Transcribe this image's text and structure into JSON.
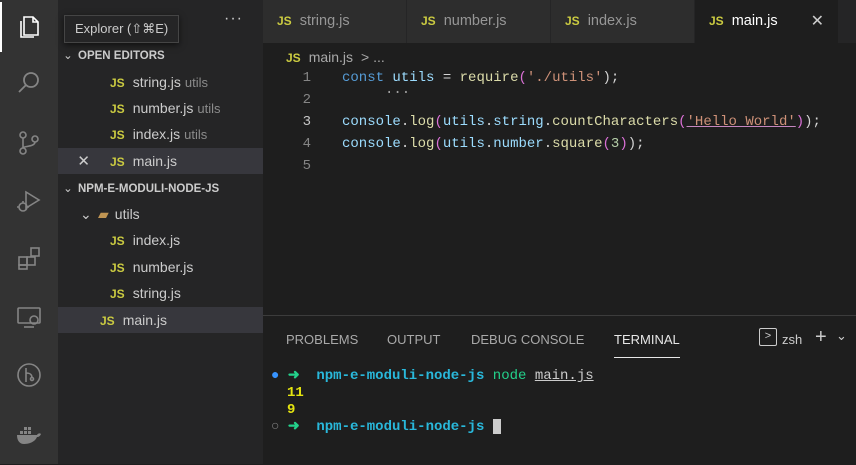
{
  "activity_bar": {
    "icons": [
      "files-icon",
      "search-icon",
      "source-control-icon",
      "run-debug-icon",
      "extensions-icon",
      "remote-explorer-icon",
      "git-graph-icon",
      "docker-icon"
    ]
  },
  "sidebar": {
    "tooltip": "Explorer (⇧⌘E)",
    "more_actions": "···",
    "open_editors": {
      "title": "OPEN EDITORS",
      "items": [
        {
          "badge": "JS",
          "name": "string.js",
          "dir": "utils"
        },
        {
          "badge": "JS",
          "name": "number.js",
          "dir": "utils"
        },
        {
          "badge": "JS",
          "name": "index.js",
          "dir": "utils"
        },
        {
          "badge": "JS",
          "name": "main.js",
          "dir": ""
        }
      ]
    },
    "project": {
      "title": "NPM-E-MODULI-NODE-JS",
      "folder": "utils",
      "files": [
        {
          "badge": "JS",
          "name": "index.js"
        },
        {
          "badge": "JS",
          "name": "number.js"
        },
        {
          "badge": "JS",
          "name": "string.js"
        }
      ],
      "root_files": [
        {
          "badge": "JS",
          "name": "main.js"
        }
      ]
    }
  },
  "tabs": [
    {
      "badge": "JS",
      "label": "string.js"
    },
    {
      "badge": "JS",
      "label": "number.js"
    },
    {
      "badge": "JS",
      "label": "index.js"
    },
    {
      "badge": "JS",
      "label": "main.js",
      "close": "✕"
    }
  ],
  "breadcrumb": {
    "badge": "JS",
    "file": "main.js",
    "sep": ">",
    "rest": "..."
  },
  "editor": {
    "line_numbers": [
      "1",
      "2",
      "3",
      "4",
      "5"
    ],
    "hover_dots": "...",
    "lines": {
      "l1": {
        "kw": "const",
        "v": "utils",
        "op": " = ",
        "fn": "require",
        "p1": "(",
        "s": "'./utils'",
        "p2": ");"
      },
      "l3": {
        "a": "console",
        "b": ".",
        "c": "log",
        "d": "(",
        "e": "utils",
        "f": ".",
        "g": "string",
        "h": ".",
        "i": "countCharacters",
        "j": "(",
        "k": "'Hello World'",
        "l": ")",
        "m": ");"
      },
      "l4": {
        "a": "console",
        "b": ".",
        "c": "log",
        "d": "(",
        "e": "utils",
        "f": ".",
        "g": "number",
        "h": ".",
        "i": "square",
        "j": "(",
        "k": "3",
        "l": ")",
        "m": ");"
      }
    }
  },
  "panel": {
    "tabs": [
      "PROBLEMS",
      "OUTPUT",
      "DEBUG CONSOLE",
      "TERMINAL"
    ],
    "shell": "zsh",
    "shell_icon": ">",
    "add_icon": "+",
    "chevron": "⌄",
    "terminal": {
      "prompt_dir": "npm-e-moduli-node-js",
      "arrow": "➜",
      "command": "node",
      "arg": "main.js",
      "output": [
        "11",
        "9"
      ]
    }
  },
  "colors": {
    "accent": "#3794ff",
    "js_badge": "#cbcb41",
    "terminal_green": "#23d18b",
    "terminal_cyan": "#29b8db"
  }
}
